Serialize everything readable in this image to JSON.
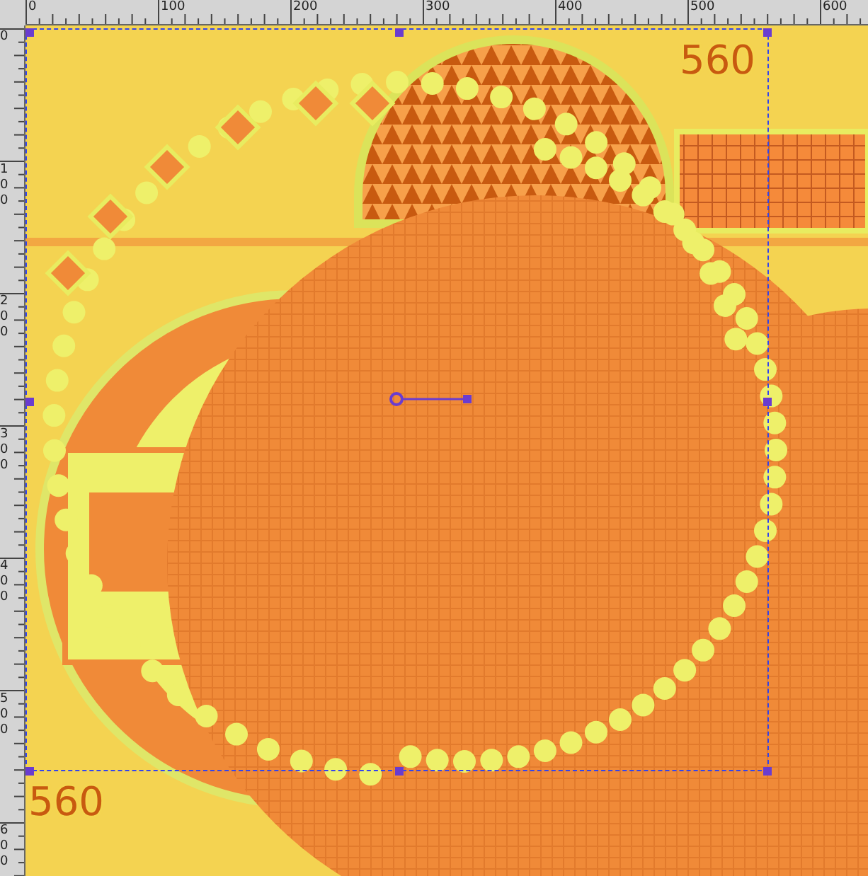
{
  "rulers": {
    "horizontal": [
      "0",
      "100",
      "200",
      "300",
      "400",
      "500",
      "600"
    ],
    "vertical": [
      "0",
      "100",
      "200",
      "300",
      "400",
      "500",
      "600"
    ]
  },
  "canvas": {
    "size_labels": [
      "560",
      "560"
    ]
  }
}
